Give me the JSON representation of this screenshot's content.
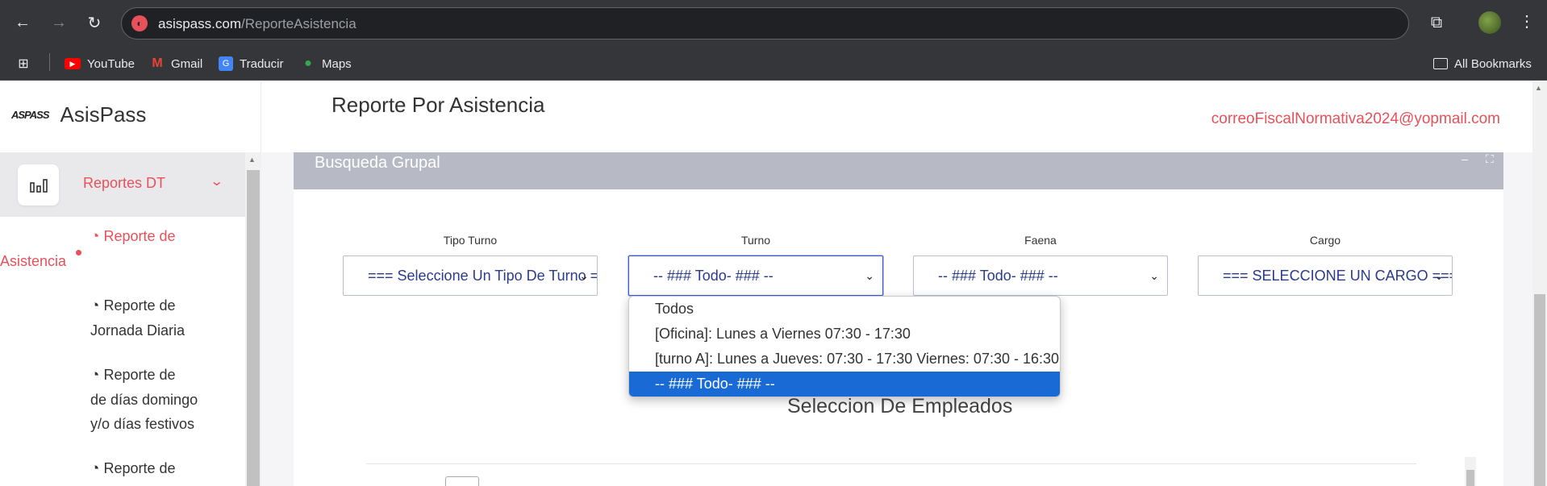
{
  "browser": {
    "url_host": "asispass.com",
    "url_path": "/ReporteAsistencia",
    "bookmarks": [
      "YouTube",
      "Gmail",
      "Traducir",
      "Maps"
    ],
    "all_bookmarks_label": "All Bookmarks"
  },
  "sidebar": {
    "logo_text": "ASPASS",
    "brand_name": "AsisPass",
    "active_menu_label": "Reportes DT",
    "sub_items": [
      {
        "line1": "Reporte de",
        "line2": "Asistencia"
      },
      {
        "line1": "Reporte de",
        "line2": "Jornada Diaria"
      },
      {
        "line1": "Reporte de",
        "line2": "de días domingo",
        "line3": "y/o días festivos"
      },
      {
        "line1": "Reporte de"
      }
    ]
  },
  "header": {
    "title": "Reporte Por Asistencia",
    "user_email": "correoFiscalNormativa2024@yopmail.com"
  },
  "card": {
    "title": "Busqueda Grupal",
    "minimize": "–",
    "expand": "⛶"
  },
  "filters": {
    "tipo_turno": {
      "label": "Tipo Turno",
      "value": "=== Seleccione Un Tipo De Turno ==="
    },
    "turno": {
      "label": "Turno",
      "value": "-- ### Todo- ### --"
    },
    "faena": {
      "label": "Faena",
      "value": "-- ### Todo- ### --"
    },
    "cargo": {
      "label": "Cargo",
      "value": "=== SELECCIONE UN CARGO ==="
    }
  },
  "turno_dropdown": {
    "options": [
      "Todos",
      "[Oficina]: Lunes a Viernes 07:30 - 17:30",
      "[turno A]: Lunes a Jueves: 07:30 - 17:30 Viernes: 07:30 - 16:30",
      "-- ### Todo- ### --"
    ],
    "selected_index": 3
  },
  "section": {
    "title": "Seleccion De Empleados"
  },
  "colors": {
    "accent": "#e8515a",
    "selected_option": "#1a6ad6",
    "card_header": "#b7bac4"
  }
}
